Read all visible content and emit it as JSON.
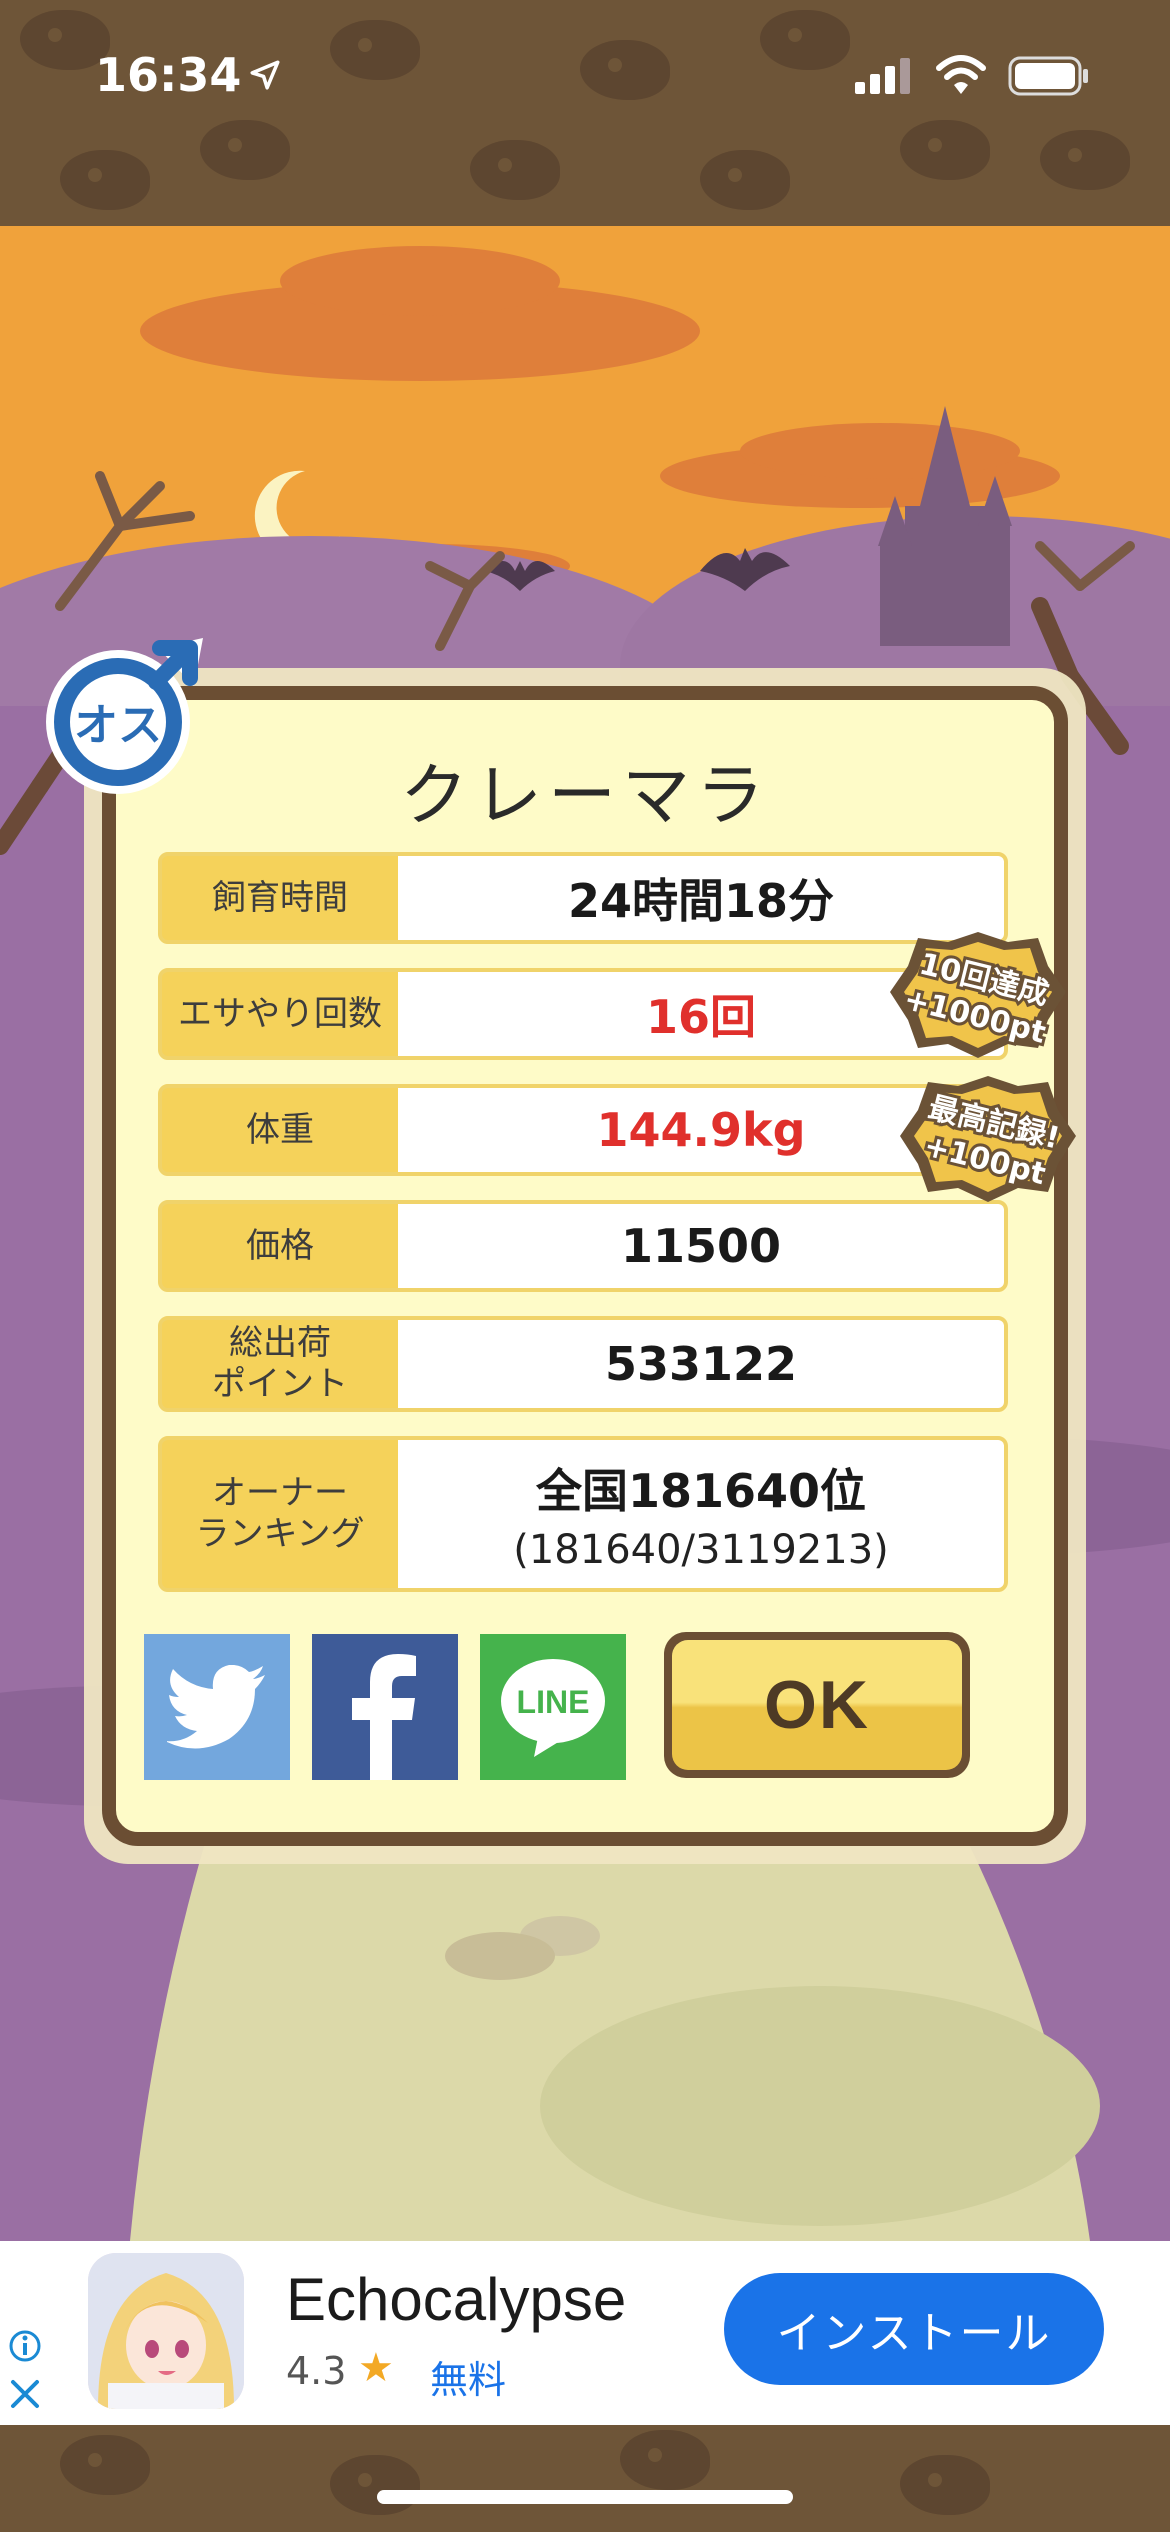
{
  "status_bar": {
    "time": "16:34",
    "icons": [
      "location-arrow-icon",
      "signal-icon",
      "wifi-icon",
      "battery-icon"
    ]
  },
  "badge": {
    "text": "オス",
    "icon": "male-symbol-icon"
  },
  "dialog": {
    "title": "クレーマラ",
    "rows": [
      {
        "label": "飼育時間",
        "value": "24時間18分",
        "highlight": false
      },
      {
        "label": "エサやり回数",
        "value": "16回",
        "highlight": true
      },
      {
        "label": "体重",
        "value": "144.9kg",
        "highlight": true
      },
      {
        "label": "価格",
        "value": "11500",
        "highlight": false
      },
      {
        "label": "総出荷\nポイント",
        "value": "533122",
        "highlight": false
      },
      {
        "label": "オーナー\nランキング",
        "value": "全国181640位",
        "sub": "(181640/3119213)",
        "highlight": false
      }
    ],
    "bonuses": [
      {
        "line1": "10回達成",
        "line2": "+1000pt"
      },
      {
        "line1": "最高記録!",
        "line2": "+100pt"
      }
    ],
    "share_buttons": [
      {
        "name": "twitter",
        "icon": "twitter-bird-icon"
      },
      {
        "name": "facebook",
        "icon": "facebook-f-icon"
      },
      {
        "name": "line",
        "icon": "line-bubble-icon",
        "text": "LINE"
      }
    ],
    "ok_label": "OK"
  },
  "ad": {
    "app_name": "Echocalypse",
    "rating": "4.3",
    "price": "無料",
    "install_label": "インストール"
  },
  "colors": {
    "sky": "#f0a23b",
    "hills": "#9a6fa3",
    "panel": "#fefbc8",
    "panel_border": "#6b4e33",
    "label_bg": "#f5d25a",
    "highlight_text": "#e0302c",
    "install_button": "#1a73e8"
  }
}
